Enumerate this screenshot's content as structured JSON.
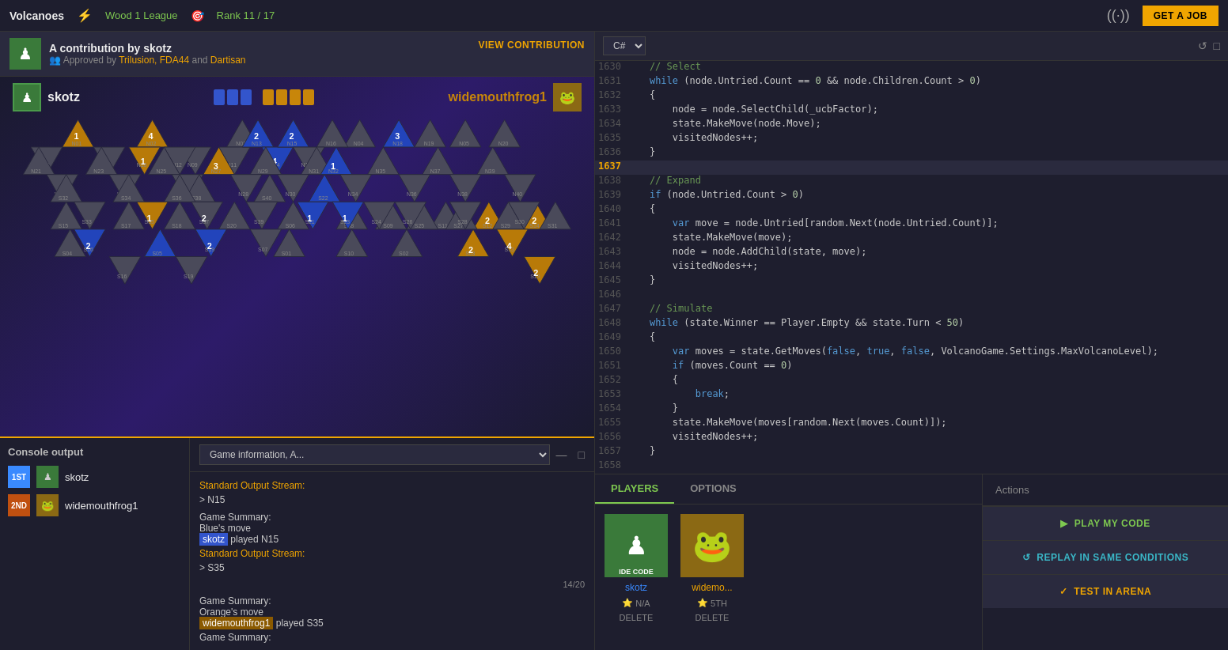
{
  "nav": {
    "title": "Volcanoes",
    "league": "Wood 1 League",
    "rank": "Rank 11 / 17",
    "get_job_label": "GET A JOB"
  },
  "contribution": {
    "title": "A contribution by skotz",
    "approvers_label": "Approved by",
    "approvers": [
      "Trilusion",
      "FDA44",
      "Dartisan"
    ],
    "view_label": "VIEW CONTRIBUTION"
  },
  "players": {
    "left": {
      "name": "skotz",
      "color": "blue"
    },
    "right": {
      "name": "widemouthfrog1",
      "color": "orange"
    }
  },
  "console": {
    "title": "Console output",
    "rank1": {
      "rank": "1ST",
      "name": "skotz"
    },
    "rank2": {
      "rank": "2ND",
      "name": "widemouthfrog1"
    }
  },
  "game_info": {
    "dropdown_label": "Game information, A...",
    "entries": [
      {
        "type": "output",
        "label": "Standard Output Stream:",
        "text": "> N15"
      },
      {
        "type": "summary",
        "title": "Game Summary:",
        "line1": "Blue's move",
        "line2": "skotz",
        "line2_rest": " played N15",
        "highlight": "blue"
      },
      {
        "type": "output",
        "label": "Standard Output Stream:",
        "text": "> S35",
        "progress": "14/20"
      },
      {
        "type": "summary",
        "title": "Game Summary:",
        "line1": "Orange's move",
        "line2": "widemouthfrog1",
        "line2_rest": " played S35",
        "highlight": "orange"
      },
      {
        "type": "summary_plain",
        "text": "Game Summary:"
      }
    ]
  },
  "code": {
    "language": "C#",
    "lines": [
      {
        "num": 1630,
        "text": "    // Select",
        "type": "comment"
      },
      {
        "num": 1631,
        "text": "    while (node.Untried.Count == 0 && node.Children.Count > 0)",
        "highlighted": false
      },
      {
        "num": 1632,
        "text": "    {",
        "highlighted": false
      },
      {
        "num": 1633,
        "text": "        node = node.SelectChild(_ucbFactor);",
        "highlighted": false
      },
      {
        "num": 1634,
        "text": "        state.MakeMove(node.Move);",
        "highlighted": false
      },
      {
        "num": 1635,
        "text": "        visitedNodes++;",
        "highlighted": false
      },
      {
        "num": 1636,
        "text": "    }",
        "highlighted": false
      },
      {
        "num": 1637,
        "text": "",
        "highlighted": true
      },
      {
        "num": 1638,
        "text": "    // Expand",
        "type": "comment"
      },
      {
        "num": 1639,
        "text": "    if (node.Untried.Count > 0)",
        "highlighted": false
      },
      {
        "num": 1640,
        "text": "    {",
        "highlighted": false
      },
      {
        "num": 1641,
        "text": "        var move = node.Untried[random.Next(node.Untried.Count)];",
        "highlighted": false
      },
      {
        "num": 1642,
        "text": "        state.MakeMove(move);",
        "highlighted": false
      },
      {
        "num": 1643,
        "text": "        node = node.AddChild(state, move);",
        "highlighted": false
      },
      {
        "num": 1644,
        "text": "        visitedNodes++;",
        "highlighted": false
      },
      {
        "num": 1645,
        "text": "    }",
        "highlighted": false
      },
      {
        "num": 1646,
        "text": "",
        "highlighted": false
      },
      {
        "num": 1647,
        "text": "    // Simulate",
        "type": "comment"
      },
      {
        "num": 1648,
        "text": "    while (state.Winner == Player.Empty && state.Turn < 50)",
        "highlighted": false
      },
      {
        "num": 1649,
        "text": "    {",
        "highlighted": false
      },
      {
        "num": 1650,
        "text": "        var moves = state.GetMoves(false, true, false, VolcanoGame.Settings.MaxVolcanoLevel);",
        "highlighted": false
      },
      {
        "num": 1651,
        "text": "        if (moves.Count == 0)",
        "highlighted": false
      },
      {
        "num": 1652,
        "text": "        {",
        "highlighted": false
      },
      {
        "num": 1653,
        "text": "            break;",
        "highlighted": false
      },
      {
        "num": 1654,
        "text": "        }",
        "highlighted": false
      },
      {
        "num": 1655,
        "text": "        state.MakeMove(moves[random.Next(moves.Count)]);",
        "highlighted": false
      },
      {
        "num": 1656,
        "text": "        visitedNodes++;",
        "highlighted": false
      },
      {
        "num": 1657,
        "text": "    }",
        "highlighted": false
      },
      {
        "num": 1658,
        "text": "",
        "highlighted": false
      }
    ]
  },
  "players_panel": {
    "tabs": [
      "PLAYERS",
      "OPTIONS"
    ],
    "active_tab": "PLAYERS",
    "player1": {
      "name": "skotz",
      "badge": "IDE CODE",
      "rank_label": "N/A",
      "delete_label": "DELETE"
    },
    "player2": {
      "name": "widemo...",
      "rank_label": "5TH",
      "delete_label": "DELETE"
    }
  },
  "actions": {
    "title": "Actions",
    "play_label": "PLAY MY CODE",
    "replay_label": "REPLAY IN SAME CONDITIONS",
    "test_label": "TEST IN ARENA"
  }
}
